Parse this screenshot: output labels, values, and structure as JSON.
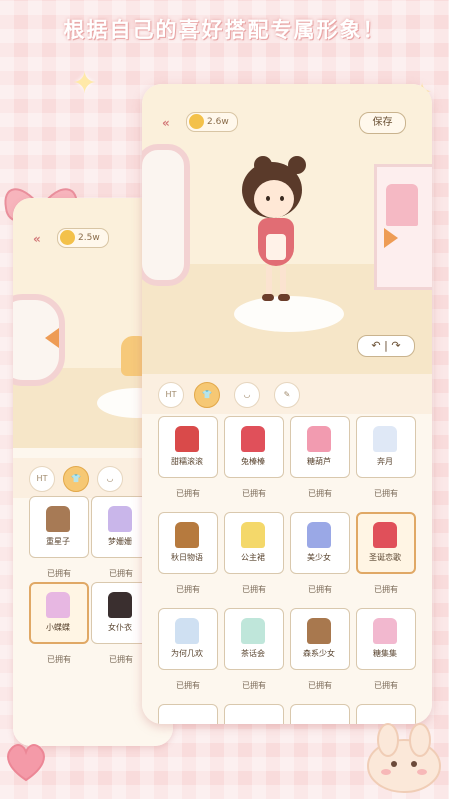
{
  "headline": "根据自己的喜好搭配专属形象！",
  "colors": {
    "accent": "#ee9c55",
    "border": "#d9c8ad",
    "background": "#f9dcdc"
  },
  "back_phone": {
    "coins": "2.5w",
    "categories": [
      "HT",
      "shirt-icon",
      "hair-icon"
    ],
    "items": [
      {
        "name": "重星子",
        "status": "已拥有"
      },
      {
        "name": "梦姗姗",
        "status": "已拥有"
      },
      {
        "name": "小蝶蝶",
        "status": "已拥有"
      },
      {
        "name": "女仆衣",
        "status": "已拥有"
      }
    ]
  },
  "front_phone": {
    "coins": "2.6w",
    "save_label": "保存",
    "undo_label": "↶ | ↷",
    "categories": [
      "HT",
      "shirt-icon",
      "hair-icon",
      "accessory-icon"
    ],
    "items": [
      {
        "name": "甜糯滚滚",
        "status": "已拥有"
      },
      {
        "name": "兔榛榛",
        "status": "已拥有"
      },
      {
        "name": "糖葫芦",
        "status": "已拥有"
      },
      {
        "name": "奔月",
        "status": "已拥有"
      },
      {
        "name": "秋日物语",
        "status": "已拥有"
      },
      {
        "name": "公主裙",
        "status": "已拥有"
      },
      {
        "name": "美少女",
        "status": "已拥有"
      },
      {
        "name": "圣诞恋歌",
        "status": "已拥有"
      },
      {
        "name": "为何几欢",
        "status": "已拥有"
      },
      {
        "name": "茶话会",
        "status": "已拥有"
      },
      {
        "name": "森系少女",
        "status": "已拥有"
      },
      {
        "name": "糖集集",
        "status": "已拥有"
      }
    ]
  }
}
